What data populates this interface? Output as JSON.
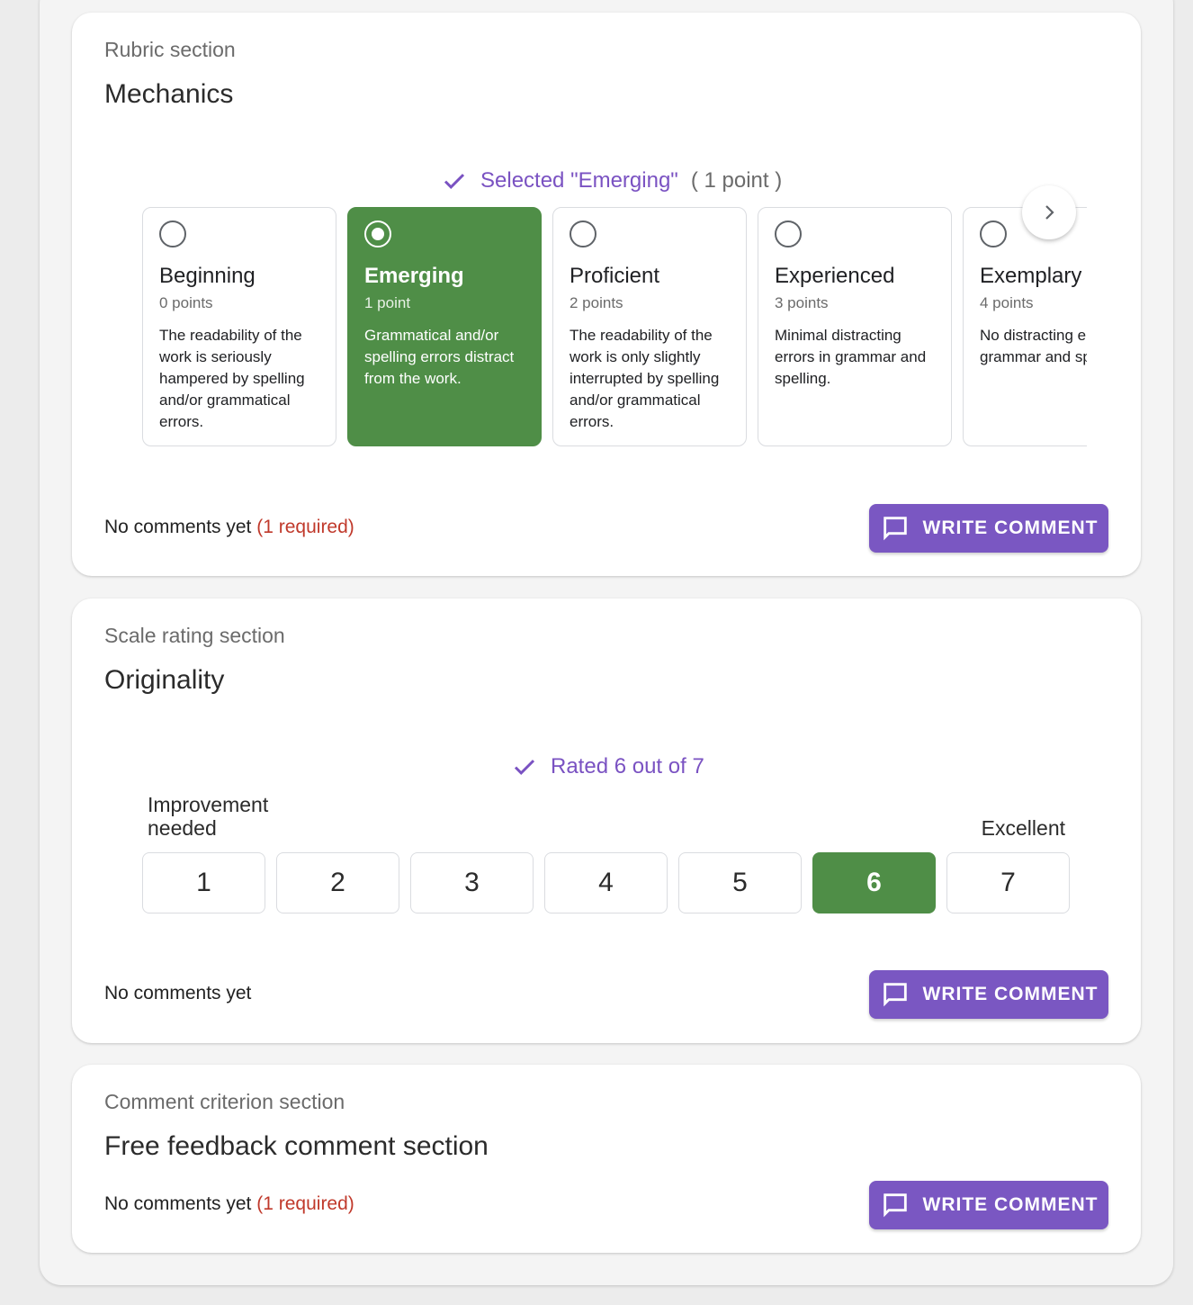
{
  "rubric": {
    "section_label": "Rubric section",
    "title": "Mechanics",
    "status_text": "Selected \"Emerging\"",
    "status_points": "( 1 point )",
    "options": [
      {
        "name": "Beginning",
        "points": "0 points",
        "description": "The readability of the work is seriously hampered by spelling and/or grammatical errors.",
        "selected": false
      },
      {
        "name": "Emerging",
        "points": "1 point",
        "description": "Grammatical and/or spelling errors distract from the work.",
        "selected": true
      },
      {
        "name": "Proficient",
        "points": "2 points",
        "description": "The readability of the work is only slightly interrupted by spelling and/or grammatical errors.",
        "selected": false
      },
      {
        "name": "Experienced",
        "points": "3 points",
        "description": "Minimal distracting errors in grammar and spelling.",
        "selected": false
      },
      {
        "name": "Exemplary",
        "points": "4 points",
        "description": "No distracting errors in grammar and spelling.",
        "selected": false
      }
    ],
    "next_icon": "chevron-right-icon",
    "comment_status": "No comments yet",
    "comment_required": "(1 required)",
    "write_comment_label": "WRITE COMMENT"
  },
  "scale": {
    "section_label": "Scale rating section",
    "title": "Originality",
    "status_text": "Rated 6 out of 7",
    "low_label": "Improvement needed",
    "high_label": "Excellent",
    "values": [
      "1",
      "2",
      "3",
      "4",
      "5",
      "6",
      "7"
    ],
    "selected_value": "6",
    "comment_status": "No comments yet",
    "write_comment_label": "WRITE COMMENT"
  },
  "comment_criterion": {
    "section_label": "Comment criterion section",
    "title": "Free feedback comment section",
    "comment_status": "No comments yet",
    "comment_required": "(1 required)",
    "write_comment_label": "WRITE COMMENT"
  },
  "colors": {
    "accent_purple": "#7a57c2",
    "selected_green": "#4f8e47",
    "required_red": "#c0392b"
  }
}
